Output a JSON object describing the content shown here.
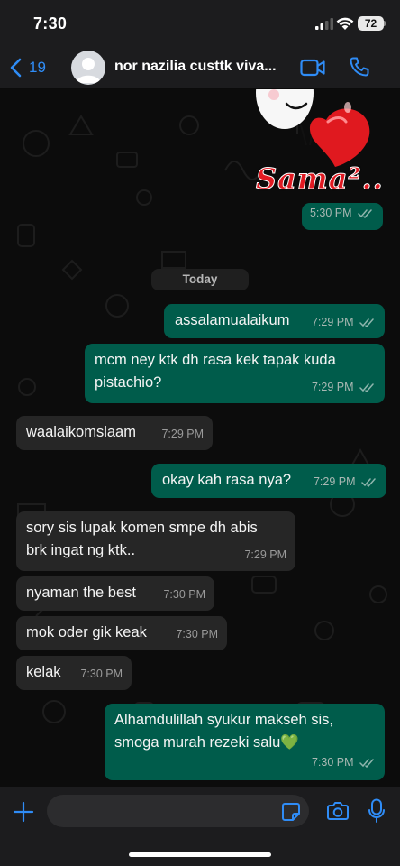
{
  "status_bar": {
    "time": "7:30",
    "battery": "72"
  },
  "header": {
    "back_count": "19",
    "contact_name": "nor nazilia custtk viva..."
  },
  "sticker": {
    "caption": "Sama²..",
    "time": "5:30 PM"
  },
  "date_divider": "Today",
  "messages": [
    {
      "direction": "out",
      "lines": [
        "assalamualaikum"
      ],
      "time": "7:29 PM"
    },
    {
      "direction": "out",
      "lines": [
        "mcm ney ktk dh rasa kek tapak kuda",
        "pistachio?"
      ],
      "time": "7:29 PM"
    },
    {
      "direction": "in",
      "lines": [
        "waalaikomslaam"
      ],
      "time": "7:29 PM"
    },
    {
      "direction": "out",
      "lines": [
        "okay kah rasa nya?"
      ],
      "time": "7:29 PM"
    },
    {
      "direction": "in",
      "lines": [
        "sory sis lupak komen smpe dh abis",
        "brk ingat ng ktk.."
      ],
      "time": "7:29 PM"
    },
    {
      "direction": "in",
      "lines": [
        "nyaman the best"
      ],
      "time": "7:30 PM"
    },
    {
      "direction": "in",
      "lines": [
        "mok oder gik keak"
      ],
      "time": "7:30 PM"
    },
    {
      "direction": "in",
      "lines": [
        "kelak"
      ],
      "time": "7:30 PM"
    },
    {
      "direction": "out",
      "lines": [
        "Alhamdulillah syukur makseh sis,",
        "smoga murah rezeki salu💚"
      ],
      "time": "7:30 PM"
    }
  ],
  "colors": {
    "outgoing_bubble": "#005c4b",
    "incoming_bubble": "#262626",
    "accent_blue": "#2f8cf6",
    "read_ticks": "#8fb5ad"
  },
  "icons": {
    "back": "chevron-left-icon",
    "video": "video-camera-icon",
    "call": "phone-icon",
    "attach": "plus-icon",
    "sticker": "sticker-icon",
    "camera": "camera-icon",
    "mic": "microphone-icon"
  },
  "composer": {
    "placeholder": ""
  }
}
